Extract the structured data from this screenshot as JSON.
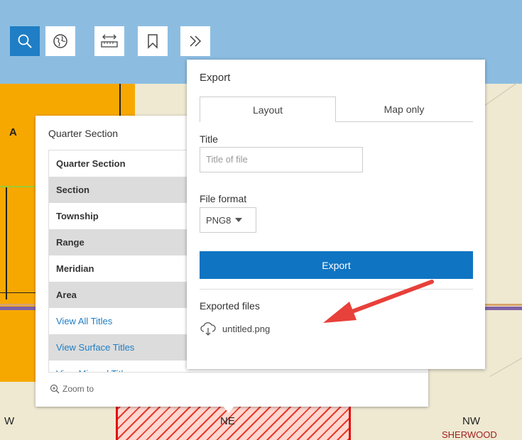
{
  "map": {
    "labels": {
      "a": "A",
      "w": "W",
      "ne": "NE",
      "nw": "NW",
      "sherwood": "SHERWOOD"
    }
  },
  "toolbar": {
    "buttons": [
      {
        "name": "search-button",
        "icon": "search-icon"
      },
      {
        "name": "basemap-button",
        "icon": "basemap-globe-icon"
      },
      {
        "name": "measure-button",
        "icon": "ruler-icon"
      },
      {
        "name": "bookmark-button",
        "icon": "bookmark-icon"
      },
      {
        "name": "expand-button",
        "icon": "double-chevron-right-icon"
      }
    ]
  },
  "popup": {
    "title": "Quarter Section",
    "rows": [
      {
        "label": "Quarter Section",
        "shaded": false,
        "link": false
      },
      {
        "label": "Section",
        "shaded": true,
        "link": false
      },
      {
        "label": "Township",
        "shaded": false,
        "link": false
      },
      {
        "label": "Range",
        "shaded": true,
        "link": false
      },
      {
        "label": "Meridian",
        "shaded": false,
        "link": false
      },
      {
        "label": "Area",
        "shaded": true,
        "link": false
      },
      {
        "label": "View All Titles",
        "shaded": false,
        "link": true
      },
      {
        "label": "View Surface Titles",
        "shaded": true,
        "link": true
      },
      {
        "label": "View Mineral Titles",
        "shaded": false,
        "link": true
      }
    ],
    "zoom_label": "Zoom to"
  },
  "export": {
    "title": "Export",
    "tabs": [
      "Layout",
      "Map only"
    ],
    "selected_tab": "Layout",
    "title_label": "Title",
    "title_placeholder": "Title of file",
    "format_label": "File format",
    "format_value": "PNG8",
    "export_button": "Export",
    "exported_label": "Exported files",
    "files": [
      "untitled.png"
    ]
  },
  "colors": {
    "accent": "#0f74c2",
    "annotation_arrow": "#e8403a",
    "map_orange": "#f7a800",
    "map_blue": "#8cbde1"
  }
}
